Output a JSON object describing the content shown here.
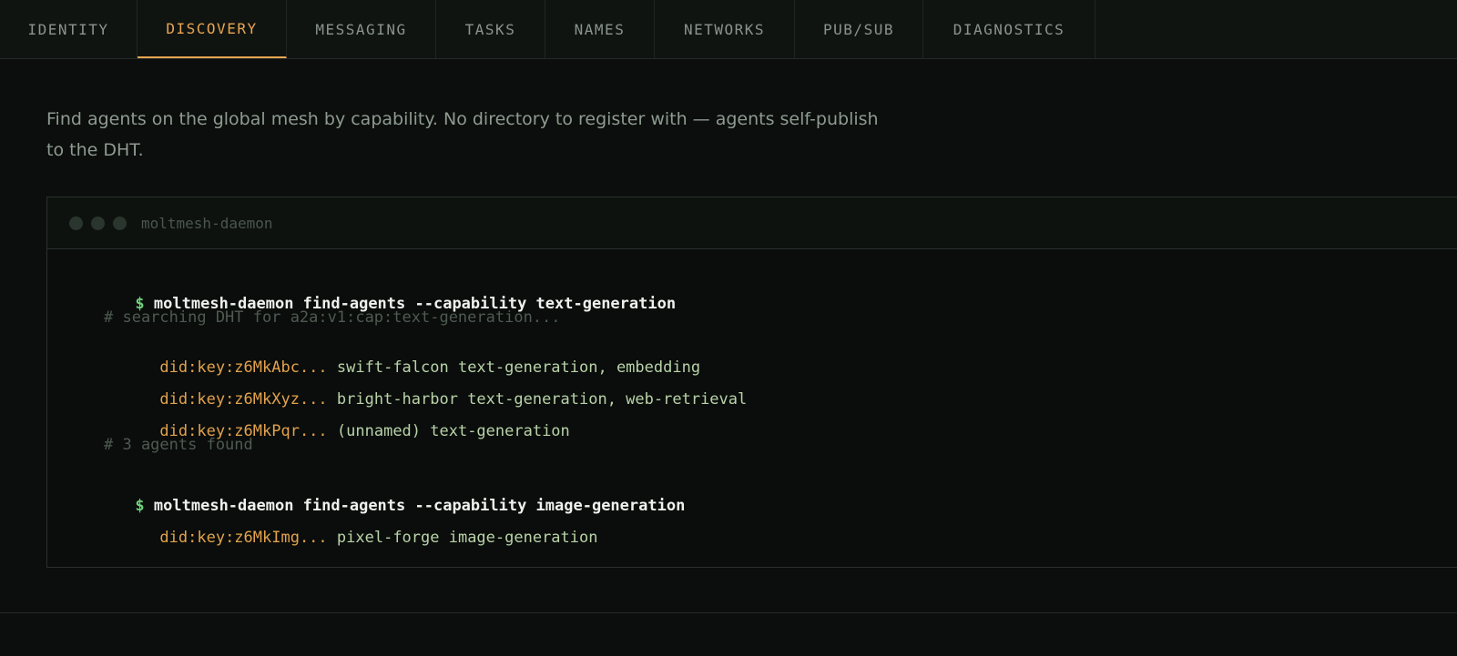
{
  "tabs": [
    {
      "label": "IDENTITY",
      "active": false
    },
    {
      "label": "DISCOVERY",
      "active": true
    },
    {
      "label": "MESSAGING",
      "active": false
    },
    {
      "label": "TASKS",
      "active": false
    },
    {
      "label": "NAMES",
      "active": false
    },
    {
      "label": "NETWORKS",
      "active": false
    },
    {
      "label": "PUB/SUB",
      "active": false
    },
    {
      "label": "DIAGNOSTICS",
      "active": false
    }
  ],
  "intro": "Find agents on the global mesh by capability. No directory to register with — agents self-publish to the DHT.",
  "terminal": {
    "title": "moltmesh-daemon",
    "prompt_symbol": "$",
    "command_1": "moltmesh-daemon find-agents --capability text-generation",
    "comment_searching": "# searching DHT for a2a:v1:cap:text-generation...",
    "results_1": [
      {
        "did": "did:key:z6MkAbc...",
        "info": "swift-falcon text-generation, embedding"
      },
      {
        "did": "did:key:z6MkXyz...",
        "info": "bright-harbor text-generation, web-retrieval"
      },
      {
        "did": "did:key:z6MkPqr...",
        "info": "(unnamed) text-generation"
      }
    ],
    "comment_found": "# 3 agents found",
    "command_2": "moltmesh-daemon find-agents --capability image-generation",
    "results_2": [
      {
        "did": "did:key:z6MkImg...",
        "info": "pixel-forge image-generation"
      }
    ]
  },
  "colors": {
    "accent": "#e8a552",
    "prompt": "#6fd17c",
    "did": "#e3a24c",
    "result_text": "#b9d2a8",
    "background": "#0b0e0c"
  }
}
